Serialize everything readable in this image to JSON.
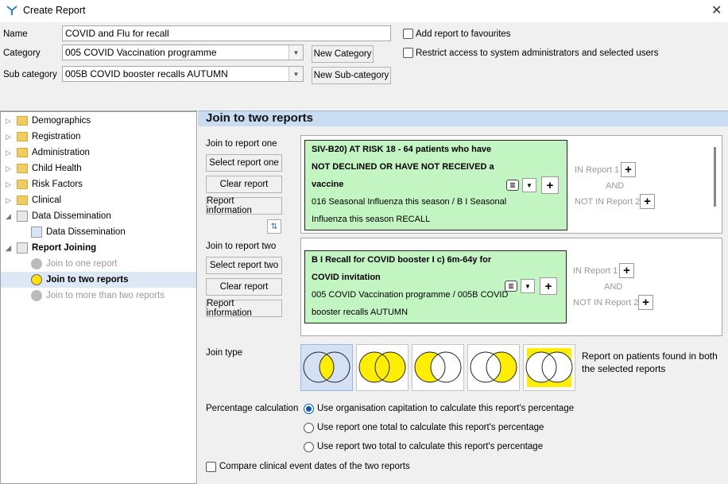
{
  "window": {
    "title": "Create Report"
  },
  "form": {
    "name_label": "Name",
    "name_value": "COVID and Flu for recall",
    "category_label": "Category",
    "category_value": "005 COVID Vaccination programme",
    "subcategory_label": "Sub category",
    "subcategory_value": "005B COVID booster recalls AUTUMN",
    "new_category": "New Category",
    "new_subcategory": "New Sub-category",
    "add_favourites": "Add report to favourites",
    "restrict_access": "Restrict access to system administrators and selected users"
  },
  "tree": {
    "items": [
      {
        "label": "Demographics"
      },
      {
        "label": "Registration"
      },
      {
        "label": "Administration"
      },
      {
        "label": "Child Health"
      },
      {
        "label": "Risk Factors"
      },
      {
        "label": "Clinical"
      },
      {
        "label": "Data Dissemination"
      },
      {
        "label": "Data Dissemination"
      },
      {
        "label": "Report Joining"
      },
      {
        "label": "Join to one report"
      },
      {
        "label": "Join to two reports"
      },
      {
        "label": "Join to more than two reports"
      }
    ]
  },
  "panel": {
    "title": "Join to two reports",
    "join_one_label": "Join to report one",
    "join_two_label": "Join to report two",
    "select_one": "Select report one",
    "select_two": "Select report two",
    "clear": "Clear report",
    "info": "Report information",
    "report1": {
      "title_l1": "SIV-B20) AT RISK 18 - 64 patients who have",
      "title_l2": "NOT DECLINED OR HAVE NOT RECEIVED a",
      "title_l3": "vaccine",
      "path_l1": "016 Seasonal Influenza this season / B I Seasonal",
      "path_l2": "Influenza this season RECALL"
    },
    "report2": {
      "title_l1": "B I Recall for COVID booster I c) 6m-64y for",
      "title_l2": "COVID invitation",
      "path_l1": "005 COVID Vaccination programme / 005B COVID",
      "path_l2": "booster recalls AUTUMN"
    },
    "in_report1": "IN Report 1",
    "and": "AND",
    "not_in_report2": "NOT IN Report 2",
    "join_type_label": "Join type",
    "join_type_desc": "Report on patients found in both the selected reports",
    "pct_label": "Percentage calculation",
    "pct_options": [
      "Use organisation capitation to calculate this report's percentage",
      "Use report one total to calculate this report's percentage",
      "Use report two total to calculate this report's percentage"
    ],
    "compare_dates": "Compare clinical event dates of the two reports"
  },
  "colors": {
    "accent": "#0b58b8",
    "venn_fill": "#ffee00",
    "report_bg": "#c3f5c3",
    "header_bg": "#c9dcf2"
  }
}
